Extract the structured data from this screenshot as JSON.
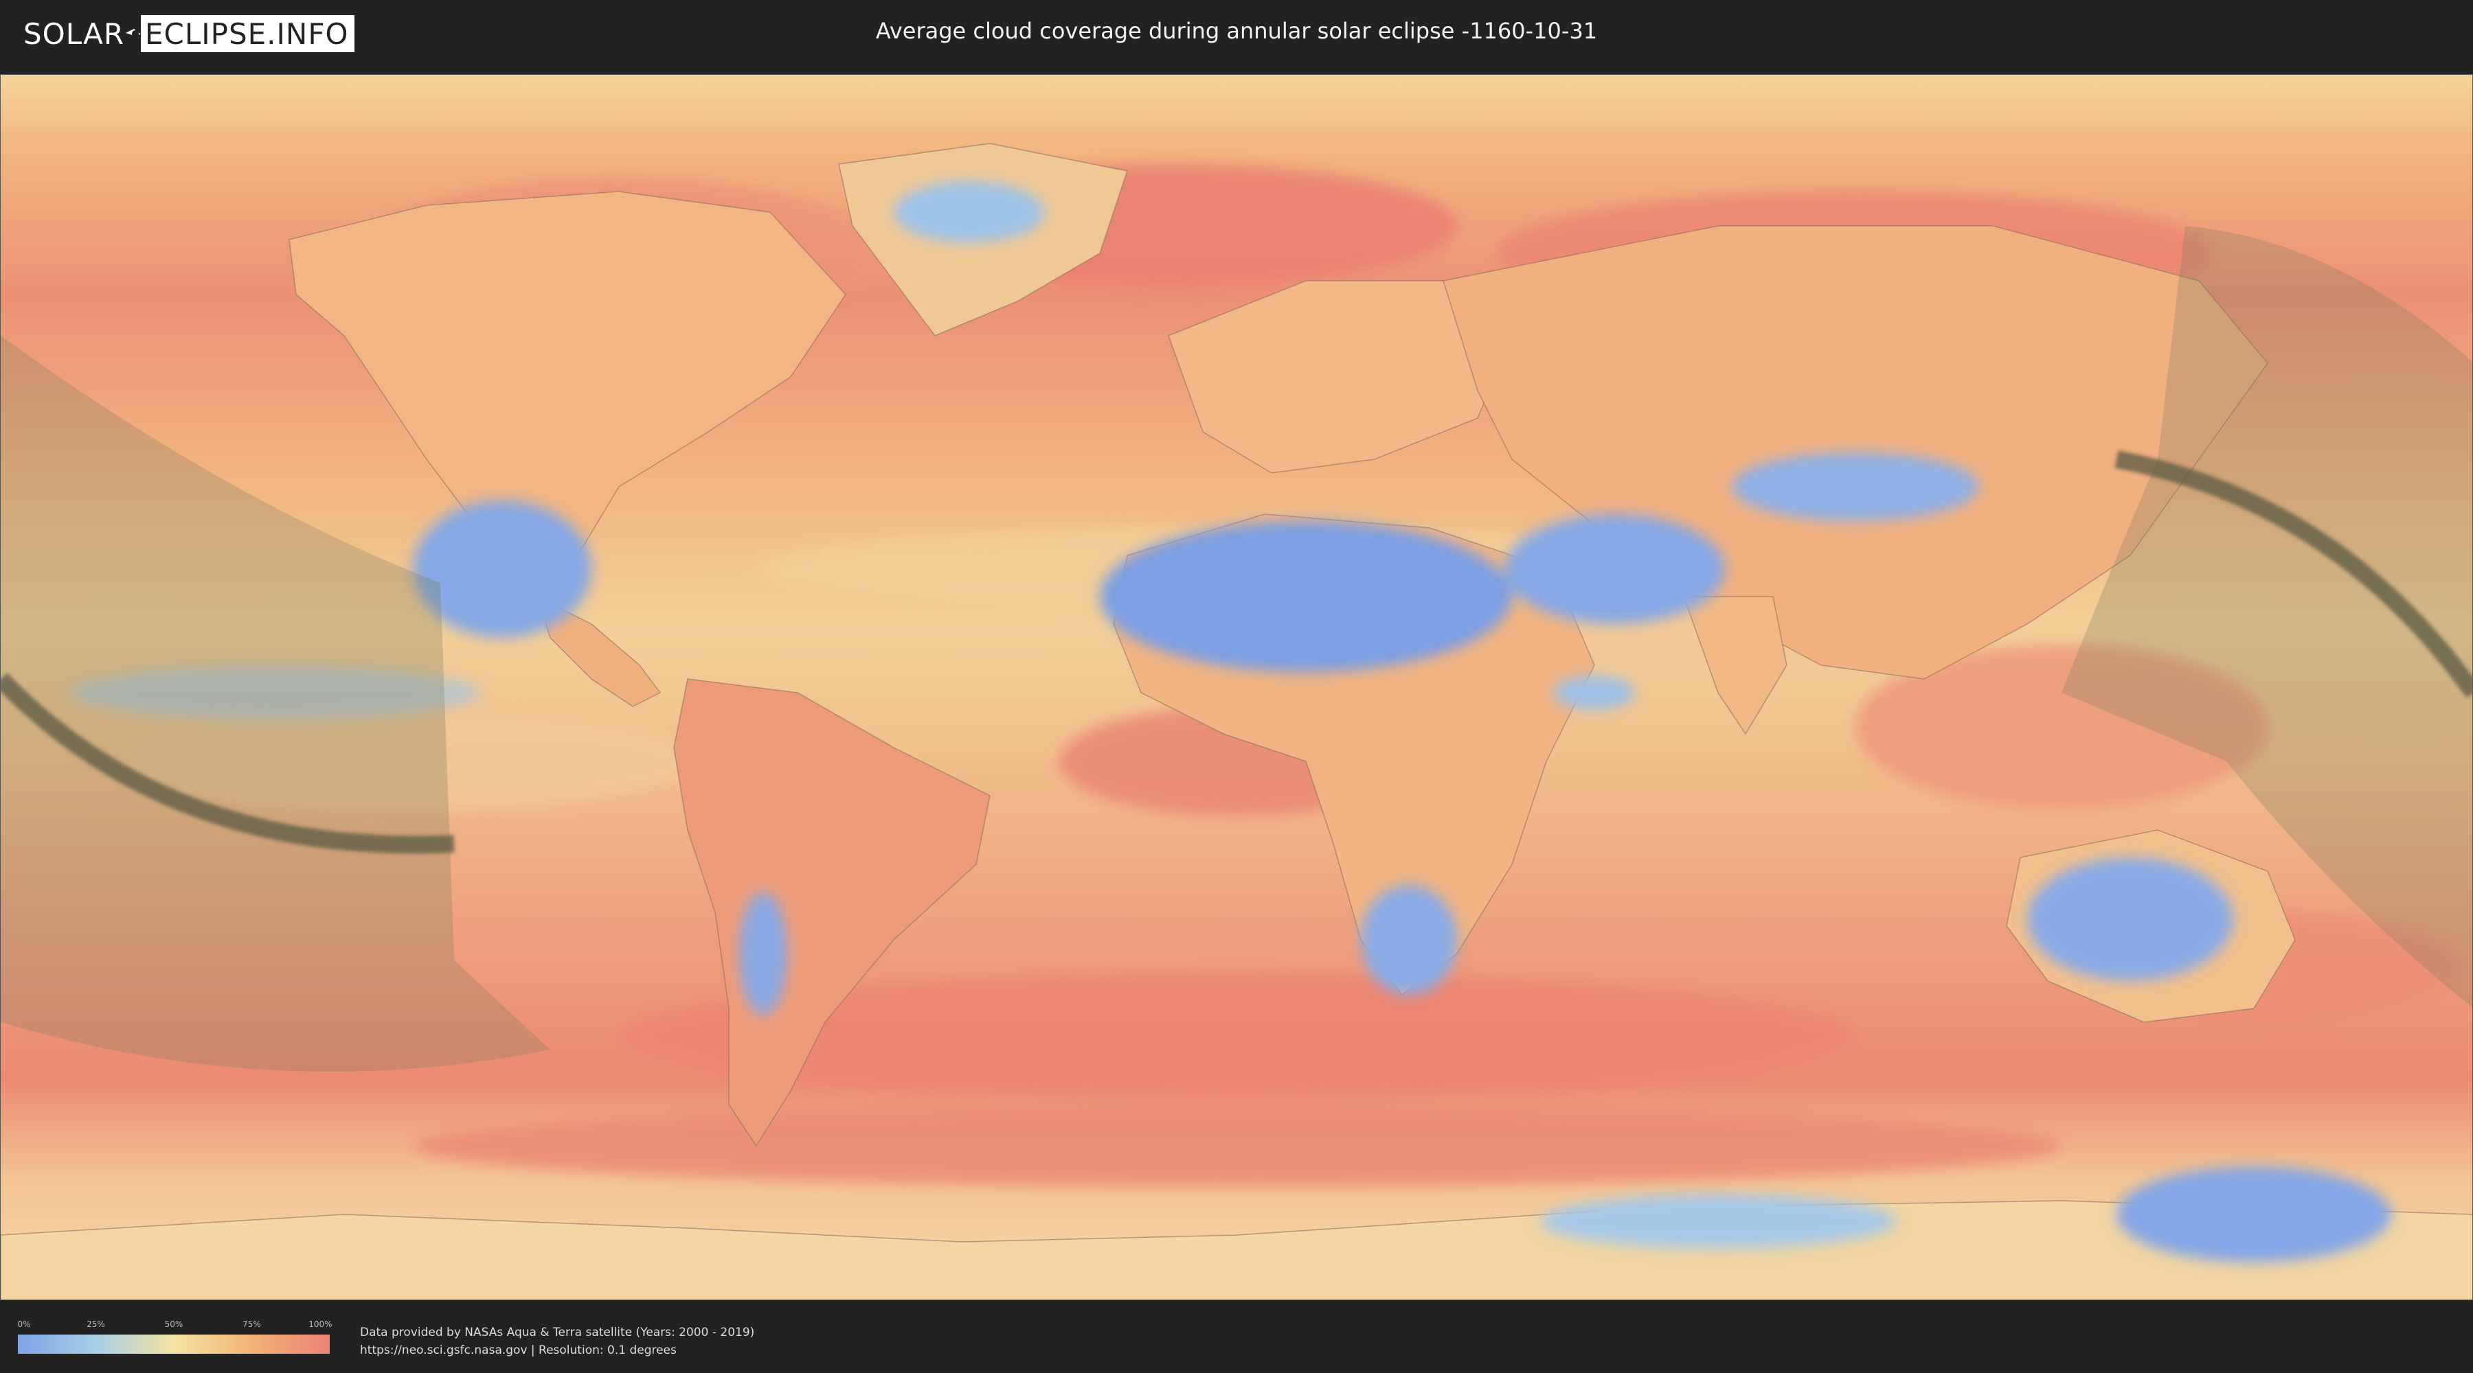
{
  "header": {
    "logo_left": "SOLAR",
    "logo_right": "ECLIPSE.INFO",
    "title": "Average cloud coverage during annular solar eclipse -1160-10-31"
  },
  "legend": {
    "ticks": [
      "0%",
      "25%",
      "50%",
      "75%",
      "100%"
    ],
    "colors": [
      "#7fa3e6",
      "#a8cfe6",
      "#f3e3a4",
      "#f2b476",
      "#ec8176"
    ]
  },
  "footer": {
    "credit_line1": "Data provided by NASAs Aqua & Terra satellite (Years: 2000 - 2019)",
    "credit_line2": "https://neo.sci.gsfc.nasa.gov | Resolution: 0.1 degrees"
  },
  "map": {
    "ocean_color": "#f0a77e",
    "dark_path_color": "#5a5a44",
    "shade_color": "#7b7b5a",
    "icons": [
      "solar-eclipse-mark"
    ]
  }
}
